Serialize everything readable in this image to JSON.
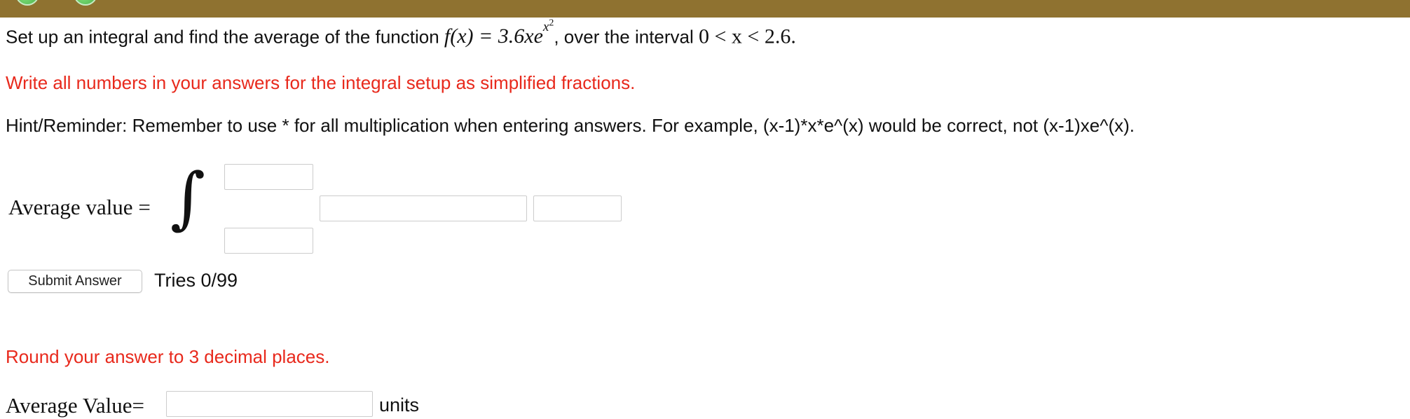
{
  "question": {
    "intro": "Set up an integral and find the average of the function ",
    "function_lhs": "f(x) = 3.6xe",
    "exponent_base": "x",
    "exponent_power": "2",
    "interval_text": ", over the interval ",
    "interval": "0 < x < 2.6."
  },
  "instructions": {
    "fractions_note": "Write all numbers in your answers for the integral setup as simplified fractions.",
    "hint": "Hint/Reminder: Remember to use * for all multiplication when entering answers. For example, (x-1)*x*e^(x) would be correct, not (x-1)xe^(x).",
    "round_note": "Round your answer to 3 decimal places."
  },
  "integral_setup": {
    "label": "Average value =",
    "integral_symbol": "∫",
    "upper_limit_value": "",
    "lower_limit_value": "",
    "integrand_value": "",
    "differential_value": ""
  },
  "submission": {
    "button_label": "Submit Answer",
    "tries": "Tries 0/99"
  },
  "final_answer": {
    "label": "Average Value=",
    "value": "",
    "units": "units"
  },
  "colors": {
    "topbar": "#8f7230",
    "emphasis_red": "#e8291c"
  },
  "icons": {
    "left_nav": "back-arrow-icon",
    "right_nav": "forward-arrow-icon"
  }
}
